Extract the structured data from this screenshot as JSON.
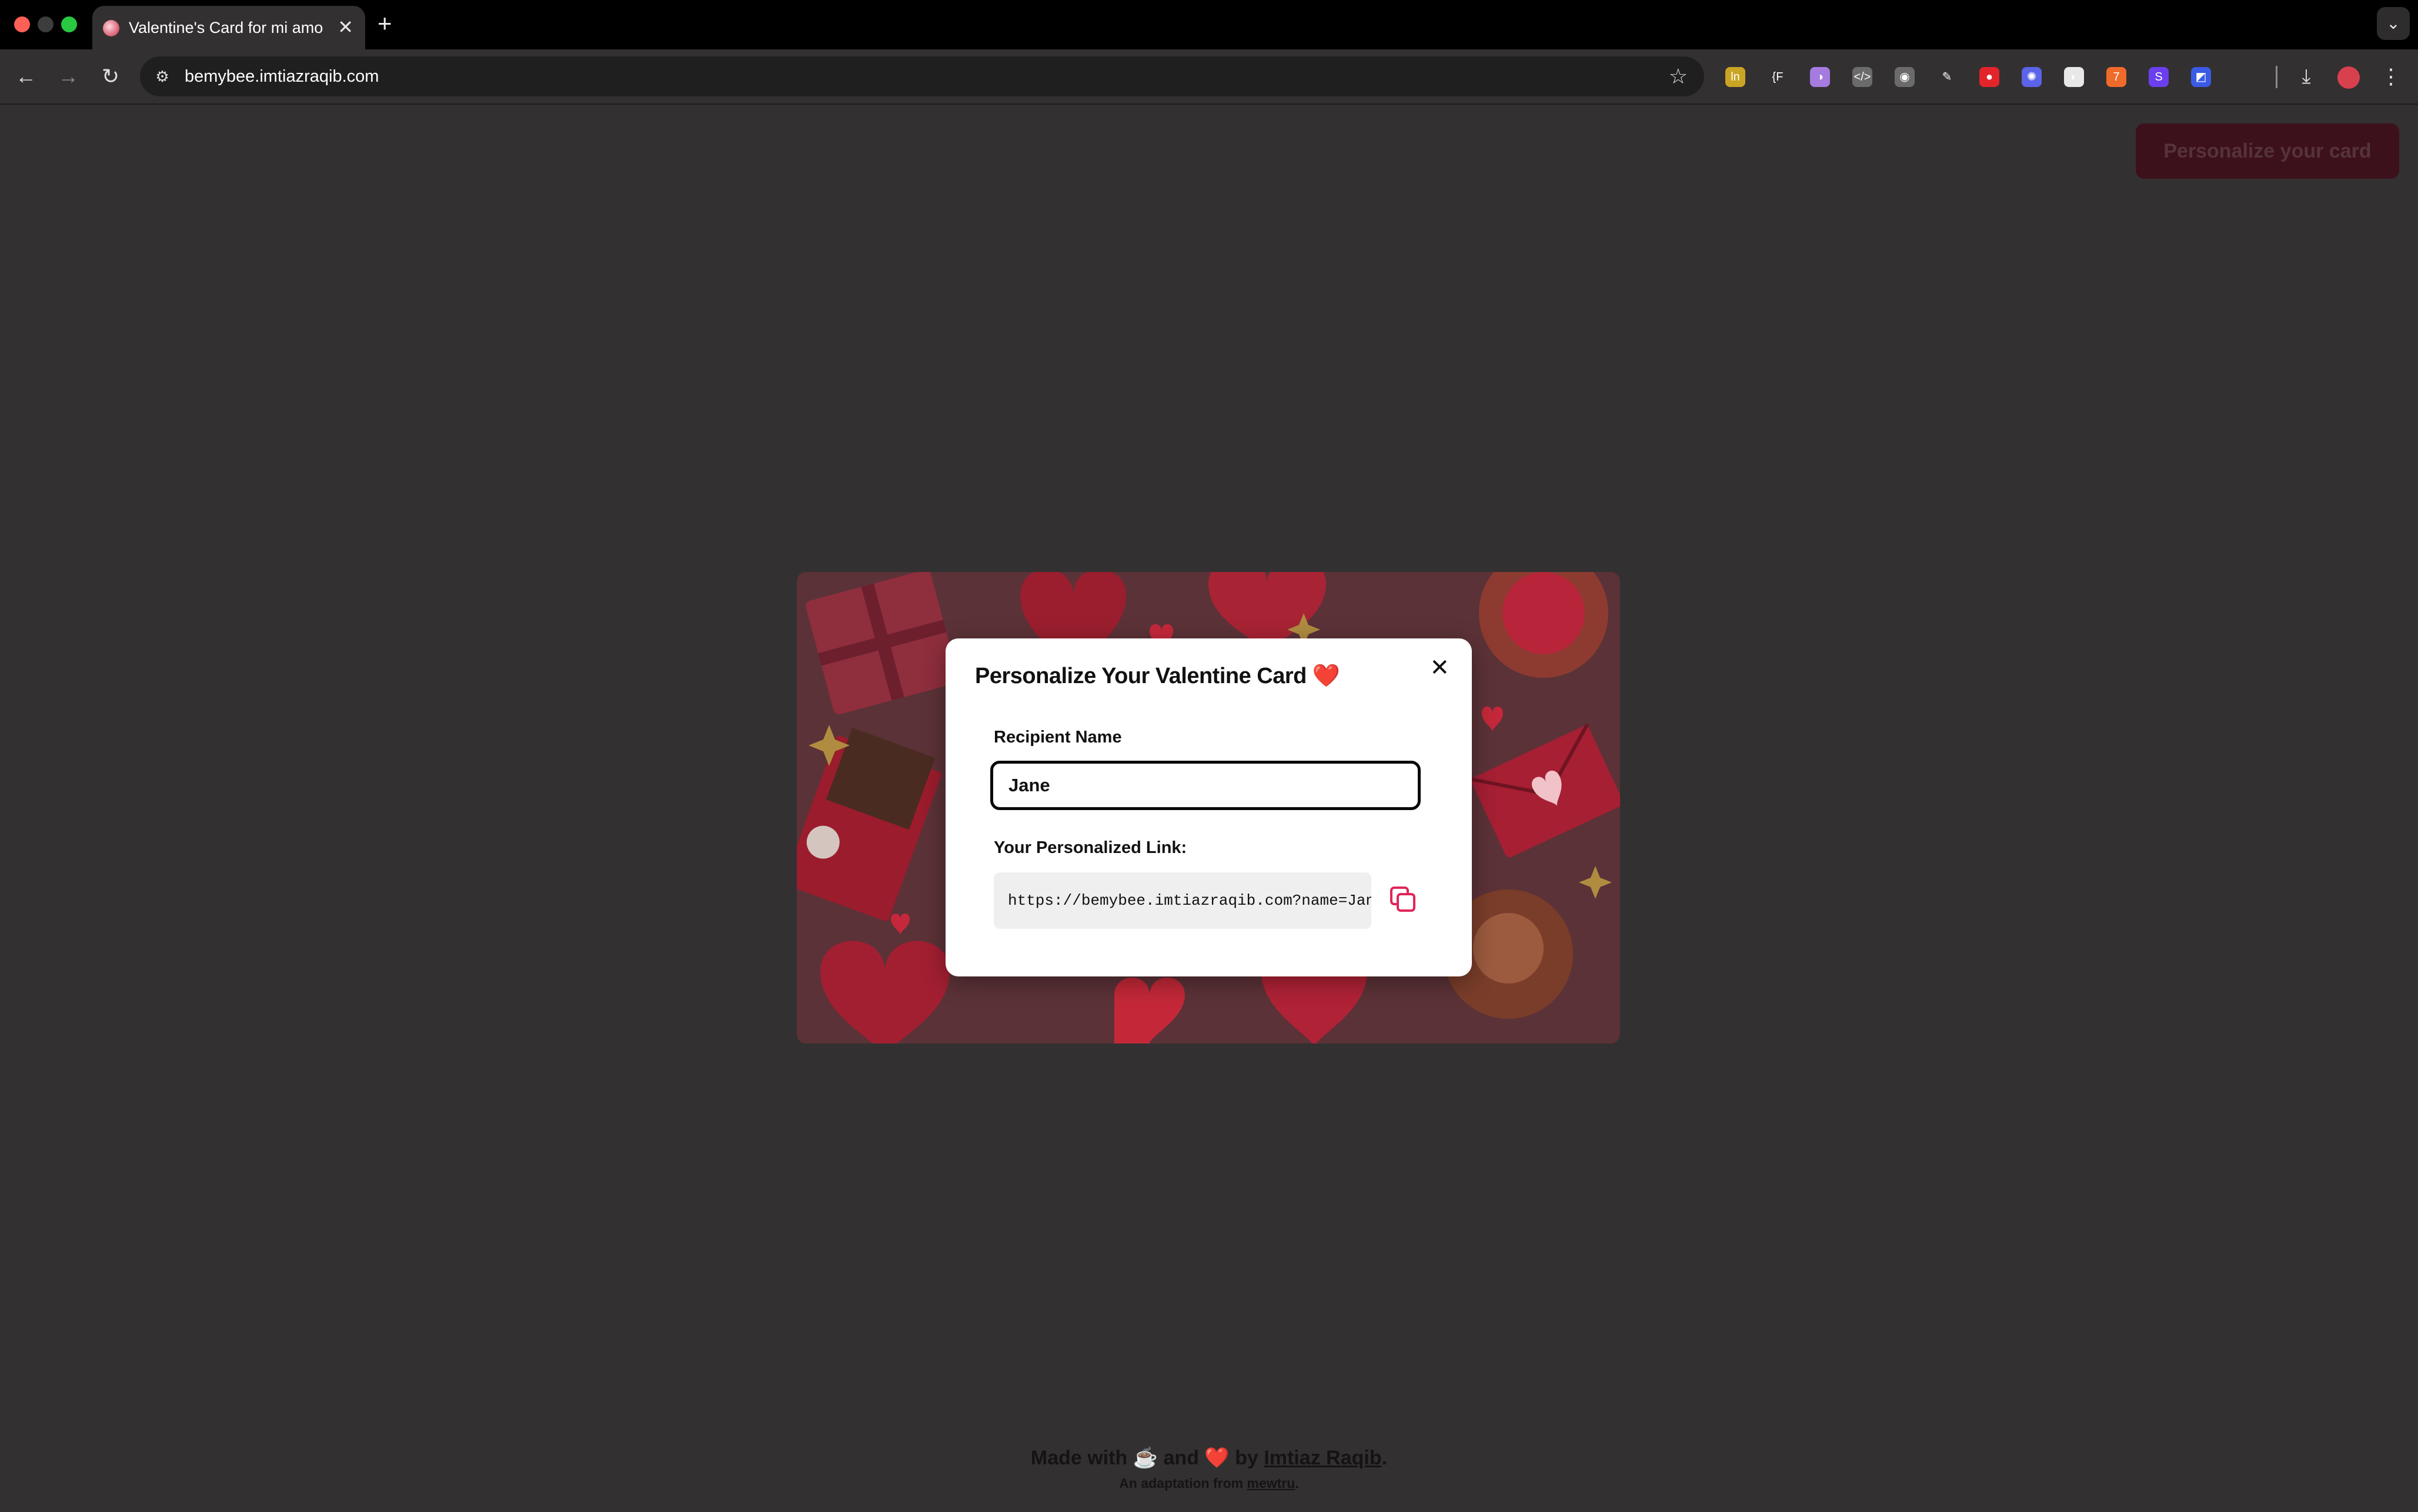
{
  "browser": {
    "tab_title": "Valentine's Card for mi amor",
    "tab_close": "✕",
    "new_tab": "+",
    "url": "bemybee.imtiazraqib.com",
    "tabs_dropdown": "⌄"
  },
  "extensions": [
    {
      "name": "ext-1",
      "color": "#caa524",
      "glyph": "ln"
    },
    {
      "name": "ext-2",
      "color": "#333031",
      "glyph": "{F"
    },
    {
      "name": "ext-3",
      "color": "#a57be0",
      "glyph": "◑"
    },
    {
      "name": "ext-4",
      "color": "#6b6b6b",
      "glyph": "</>"
    },
    {
      "name": "ext-5",
      "color": "#6b6b6b",
      "glyph": "◉"
    },
    {
      "name": "ext-6",
      "color": "#333031",
      "glyph": "✎"
    },
    {
      "name": "ext-7",
      "color": "#e3242b",
      "glyph": "●"
    },
    {
      "name": "ext-8",
      "color": "#5b63e8",
      "glyph": "✺"
    },
    {
      "name": "ext-9",
      "color": "#e8e8e8",
      "glyph": "◐"
    },
    {
      "name": "ext-10",
      "color": "#f06a2a",
      "glyph": "7"
    },
    {
      "name": "ext-11",
      "color": "#6b3ff0",
      "glyph": "S"
    },
    {
      "name": "ext-12",
      "color": "#3b5ae6",
      "glyph": "◩"
    }
  ],
  "page": {
    "personalize_button": "Personalize your card"
  },
  "modal": {
    "title": "Personalize Your Valentine Card",
    "title_emoji": "❤️",
    "close": "✕",
    "recipient_label": "Recipient Name",
    "recipient_value": "Jane",
    "link_label": "Your Personalized Link:",
    "link_value": "https://bemybee.imtiazraqib.com?name=Jane"
  },
  "footer": {
    "made_with": "Made with",
    "coffee": "☕",
    "and": "and",
    "heart": "❤️",
    "by": "by",
    "author": "Imtiaz Raqib",
    "period": ".",
    "adaptation": "An adaptation from",
    "source": "mewtru",
    "period2": "."
  }
}
